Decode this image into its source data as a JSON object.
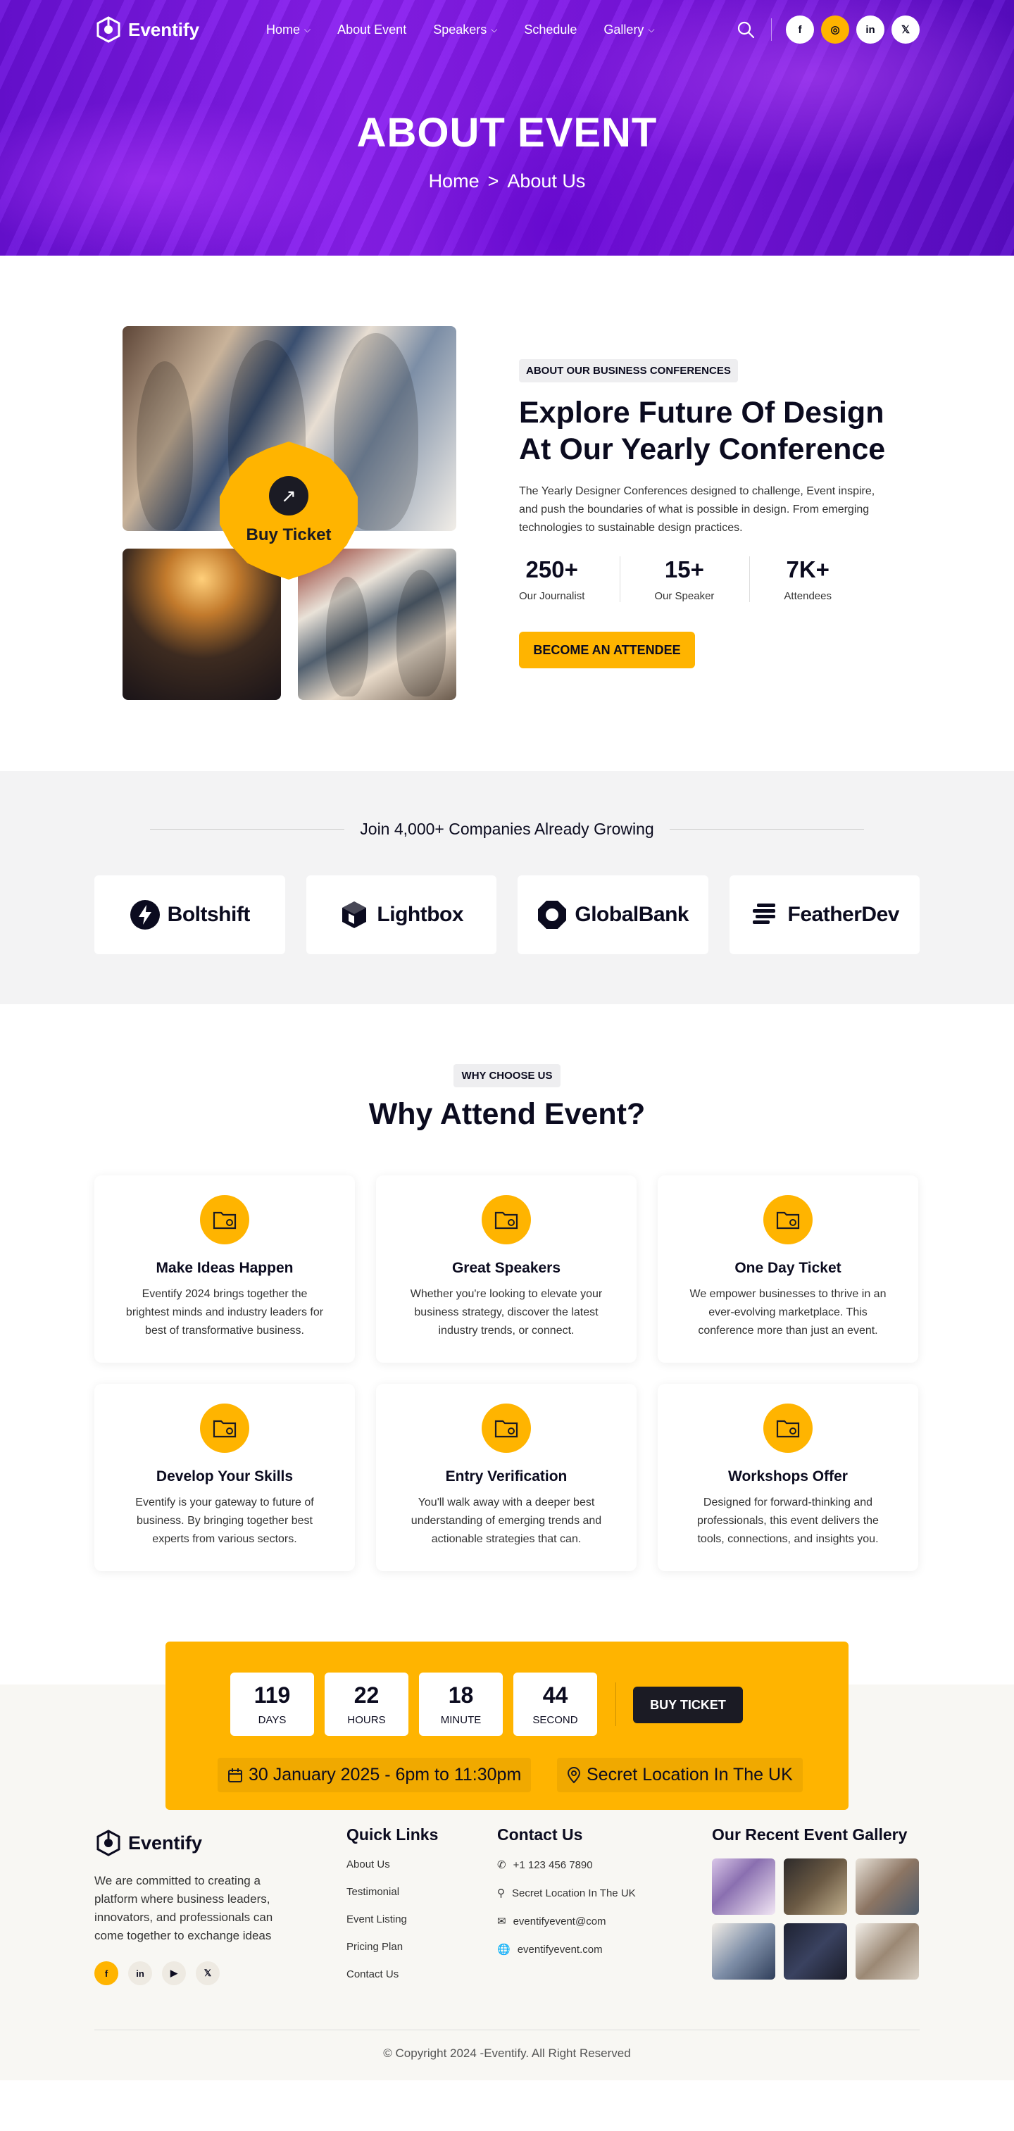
{
  "brand": {
    "name": "Eventify"
  },
  "nav": {
    "items": [
      {
        "label": "Home",
        "dropdown": true
      },
      {
        "label": "About Event",
        "dropdown": false
      },
      {
        "label": "Speakers",
        "dropdown": true
      },
      {
        "label": "Schedule",
        "dropdown": false
      },
      {
        "label": "Gallery",
        "dropdown": true
      }
    ],
    "socials": [
      {
        "icon": "facebook-icon",
        "glyph": "f"
      },
      {
        "icon": "instagram-icon",
        "glyph": "◎"
      },
      {
        "icon": "linkedin-icon",
        "glyph": "in"
      },
      {
        "icon": "x-icon",
        "glyph": "𝕏"
      }
    ]
  },
  "hero": {
    "title": "ABOUT EVENT",
    "breadcrumb": {
      "home": "Home",
      "sep": ">",
      "current": "About Us"
    }
  },
  "about": {
    "badge_label": "Buy Ticket",
    "tag": "ABOUT OUR BUSINESS CONFERENCES",
    "heading": "Explore Future Of Design At Our Yearly Conference",
    "paragraph": "The Yearly Designer Conferences designed to challenge, Event inspire, and push the boundaries of what is possible in design. From emerging technologies to sustainable design practices.",
    "stats": [
      {
        "value": "250+",
        "label": "Our Journalist"
      },
      {
        "value": "15+",
        "label": "Our Speaker"
      },
      {
        "value": "7K+",
        "label": "Attendees"
      }
    ],
    "cta": "BECOME AN ATTENDEE"
  },
  "companies": {
    "title": "Join 4,000+ Companies Already Growing",
    "logos": [
      "Boltshift",
      "Lightbox",
      "GlobalBank",
      "FeatherDev"
    ]
  },
  "why": {
    "tag": "WHY CHOOSE US",
    "heading": "Why Attend Event?",
    "cards": [
      {
        "title": "Make Ideas Happen",
        "text": "Eventify 2024 brings together the brightest minds and industry leaders for best of transformative business."
      },
      {
        "title": "Great Speakers",
        "text": "Whether you're looking to elevate your business strategy, discover the latest industry trends, or connect."
      },
      {
        "title": "One Day Ticket",
        "text": "We empower businesses to thrive in an ever-evolving marketplace. This conference more than just an event."
      },
      {
        "title": "Develop Your Skills",
        "text": "Eventify is your gateway to future of business. By bringing together best experts from various sectors."
      },
      {
        "title": "Entry Verification",
        "text": "You'll walk away with a deeper best understanding of emerging trends and actionable strategies that can."
      },
      {
        "title": "Workshops Offer",
        "text": "Designed for forward-thinking and professionals, this event delivers the tools, connections, and insights you."
      }
    ]
  },
  "countdown": {
    "units": [
      {
        "value": "119",
        "label": "DAYS"
      },
      {
        "value": "22",
        "label": "HOURS"
      },
      {
        "value": "18",
        "label": "MINUTE"
      },
      {
        "value": "44",
        "label": "SECOND"
      }
    ],
    "button": "BUY TICKET",
    "date": "30 January 2025 - 6pm to 11:30pm",
    "location": "Secret Location In The UK"
  },
  "footer": {
    "about": "We are committed to creating a platform where business leaders, innovators, and professionals can come together to exchange ideas",
    "quick_links_title": "Quick Links",
    "quick_links": [
      "About Us",
      "Testimonial",
      "Event Listing",
      "Pricing Plan",
      "Contact Us"
    ],
    "contact_title": "Contact Us",
    "contact": {
      "phone": "+1 123 456 7890",
      "address": "Secret Location In The UK",
      "email": "eventifyevent@com",
      "web": "eventifyevent.com"
    },
    "gallery_title": "Our Recent Event Gallery",
    "copyright": "© Copyright 2024 -Eventify. All Right Reserved"
  },
  "colors": {
    "accent": "#ffb400",
    "hero_purple": "#7a14e2",
    "dark": "#1b1b24"
  }
}
